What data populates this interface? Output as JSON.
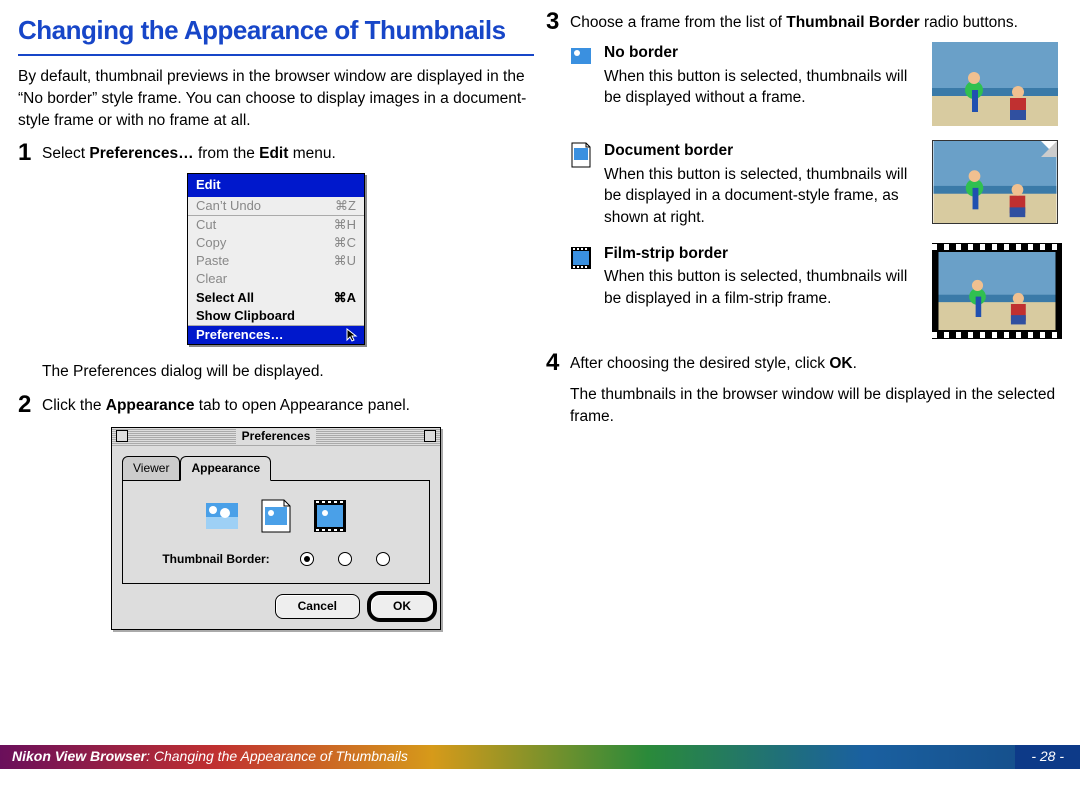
{
  "title": "Changing the Appearance of Thumbnails",
  "intro": "By default, thumbnail previews in the browser window are displayed in the “No border” style frame.  You can choose to display images in a document-style frame or with no frame at all.",
  "step1": {
    "num": "1",
    "pre": "Select ",
    "b1": "Preferences…",
    "mid": " from the ",
    "b2": "Edit",
    "post": " menu."
  },
  "edit_menu": {
    "title": "Edit",
    "cant_undo": "Can’t Undo",
    "cant_undo_sc": "⌘Z",
    "cut": "Cut",
    "cut_sc": "⌘H",
    "copy": "Copy",
    "copy_sc": "⌘C",
    "paste": "Paste",
    "paste_sc": "⌘U",
    "clear": "Clear",
    "select_all": "Select All",
    "select_all_sc": "⌘A",
    "show_clip": "Show Clipboard",
    "prefs": "Preferences…"
  },
  "after_menu": "The Preferences dialog will be displayed.",
  "step2": {
    "num": "2",
    "pre": "Click the ",
    "b": "Appearance",
    "post": " tab to open Appearance panel."
  },
  "prefs": {
    "title": "Preferences",
    "tab_viewer": "Viewer",
    "tab_appearance": "Appearance",
    "label": "Thumbnail Border:",
    "cancel": "Cancel",
    "ok": "OK"
  },
  "step3": {
    "num": "3",
    "pre": "Choose a frame from the list of ",
    "b": "Thumbnail Border",
    "post": " radio buttons."
  },
  "opt_noborder": {
    "title": "No border",
    "desc": "When this button is selected, thumbnails will be displayed without a frame."
  },
  "opt_doc": {
    "title": "Document border",
    "desc": "When this button is selected, thumbnails will be displayed in a document-style frame, as shown at right."
  },
  "opt_film": {
    "title": "Film-strip border",
    "desc": "When this button is selected, thumbnails will be displayed in a film-strip frame."
  },
  "step4": {
    "num": "4",
    "pre": "After choosing the desired style, click ",
    "b": "OK",
    "post": "."
  },
  "after4": "The thumbnails in the browser window will be displayed in the selected frame.",
  "footer": {
    "strong": "Nikon View Browser",
    "sep": ":  ",
    "text": "Changing the Appearance of Thumbnails",
    "page": "- 28 -"
  }
}
